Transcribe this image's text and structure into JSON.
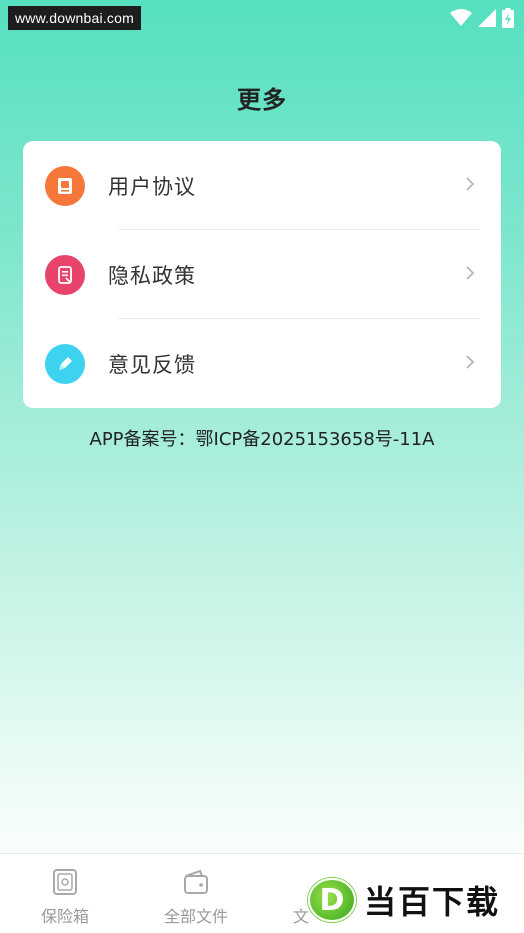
{
  "status_bar": {
    "watermark_text": "www.downbai.com",
    "icons": [
      "wifi-icon",
      "signal-icon",
      "battery-charging-icon"
    ]
  },
  "header": {
    "title": "更多"
  },
  "menu": {
    "items": [
      {
        "label": "用户协议",
        "icon": "user-agreement-icon",
        "icon_color": "#f5773a"
      },
      {
        "label": "隐私政策",
        "icon": "privacy-policy-icon",
        "icon_color": "#e8436b"
      },
      {
        "label": "意见反馈",
        "icon": "feedback-icon",
        "icon_color": "#3dd3f0"
      }
    ]
  },
  "footer_note": {
    "icp": "APP备案号：鄂ICP备2025153658号-11A"
  },
  "tab_bar": {
    "tabs": [
      {
        "label": "保险箱",
        "icon": "safe-icon"
      },
      {
        "label": "全部文件",
        "icon": "wallet-folder-icon"
      },
      {
        "label": "文",
        "icon": "document-icon"
      }
    ]
  },
  "watermark": {
    "logo_letter": "D",
    "brand_text": "当百下载"
  },
  "colors": {
    "gradient_top": "#56e0c0",
    "gradient_bottom": "#fbfefd",
    "card_bg": "#ffffff",
    "text_primary": "#333333",
    "tab_text": "#999999"
  }
}
